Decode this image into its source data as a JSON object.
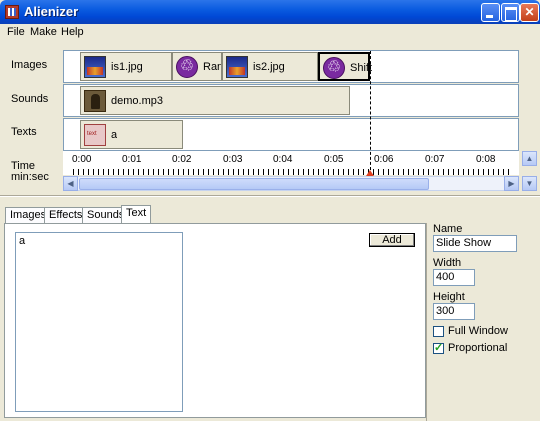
{
  "window": {
    "title": "Alienizer"
  },
  "menu": [
    "File",
    "Make",
    "Help"
  ],
  "tracks": {
    "images_label": "Images",
    "sounds_label": "Sounds",
    "texts_label": "Texts",
    "time_label_1": "Time",
    "time_label_2": "min:sec",
    "images": [
      {
        "label": "is1.jpg",
        "icon": "image-icon"
      },
      {
        "label": "Rand",
        "icon": "effect-icon"
      },
      {
        "label": "is2.jpg",
        "icon": "image-icon"
      },
      {
        "label": "Shift",
        "icon": "effect-icon"
      }
    ],
    "sounds": [
      {
        "label": "demo.mp3",
        "icon": "sound-icon"
      }
    ],
    "texts": [
      {
        "label": "a",
        "icon": "text-icon"
      }
    ]
  },
  "timeline": {
    "ticks": [
      "0:00",
      "0:01",
      "0:02",
      "0:03",
      "0:04",
      "0:05",
      "0:06",
      "0:07",
      "0:08"
    ]
  },
  "tabs": [
    "Images",
    "Effects",
    "Sounds",
    "Text"
  ],
  "active_tab": "Text",
  "text_panel": {
    "text_value": "a",
    "add_label": "Add"
  },
  "properties": {
    "name_label": "Name",
    "name_value": "Slide Show",
    "width_label": "Width",
    "width_value": "400",
    "height_label": "Height",
    "height_value": "300",
    "full_window_label": "Full Window",
    "full_window_checked": false,
    "proportional_label": "Proportional",
    "proportional_checked": true
  }
}
